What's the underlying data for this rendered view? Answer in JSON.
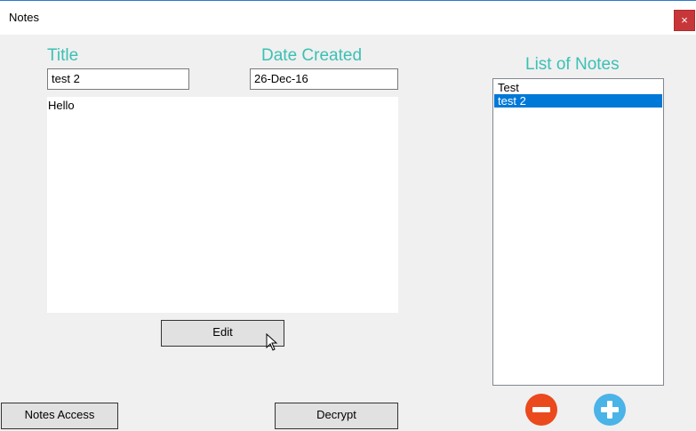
{
  "window": {
    "title": "Notes",
    "close_glyph": "×"
  },
  "editor": {
    "title_label": "Title",
    "title_value": "test 2",
    "date_label": "Date Created",
    "date_value": "26-Dec-16",
    "body_text": "Hello",
    "edit_button": "Edit"
  },
  "list": {
    "heading": "List of Notes",
    "items": [
      "Test",
      "test 2"
    ],
    "selected": "test 2"
  },
  "footer": {
    "notes_access_button": "Notes Access",
    "decrypt_button": "Decrypt"
  },
  "icons": {
    "remove": "minus-circle-icon",
    "add": "plus-circle-icon"
  },
  "colors": {
    "heading": "#3cc0b4",
    "selection": "#0078d7",
    "remove_button": "#ea4a1d",
    "add_button": "#4ab3e8",
    "close_button": "#c7373a"
  }
}
